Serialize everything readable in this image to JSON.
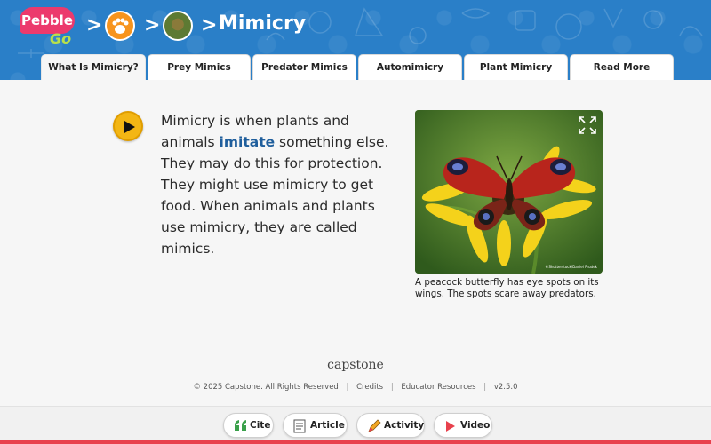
{
  "app": {
    "logo_text_top": "Pebble",
    "logo_text_bottom": "Go"
  },
  "breadcrumb": {
    "sep1": ">",
    "sep2": ">",
    "sep3": ">"
  },
  "page": {
    "title": "Mimicry"
  },
  "tabs": [
    {
      "label": "What Is Mimicry?",
      "active": true
    },
    {
      "label": "Prey Mimics",
      "active": false
    },
    {
      "label": "Predator Mimics",
      "active": false
    },
    {
      "label": "Automimicry",
      "active": false
    },
    {
      "label": "Plant Mimicry",
      "active": false
    },
    {
      "label": "Read More",
      "active": false
    }
  ],
  "article": {
    "line1": "Mimicry is when plants and",
    "line2_pre": "animals ",
    "line2_vocab": "imitate",
    "line2_post": " something else.",
    "line3": "They may do this for protection.",
    "line4": "They might use mimicry to get",
    "line5": "food. When animals and plants",
    "line6": "use mimicry, they are called mimics."
  },
  "photo": {
    "credit": "©Shutterstock/Daniel Prudek",
    "caption": "A peacock butterfly has eye spots on its wings. The spots scare away predators."
  },
  "footer": {
    "brand": "capstone",
    "copyright": "© 2025 Capstone. All Rights Reserved",
    "credits": "Credits",
    "educator": "Educator Resources",
    "version": "v2.5.0",
    "divider": "|"
  },
  "bottom_actions": {
    "cite": "Cite",
    "article": "Article",
    "activity": "Activity",
    "video": "Video"
  },
  "colors": {
    "header": "#2a7fc8",
    "accent_red": "#e8414d",
    "vocab_blue": "#1f5e9c",
    "play_yellow": "#f3b614"
  },
  "icons": {
    "play": "play-icon",
    "expand": "expand-icon",
    "cite": "quote-icon",
    "article": "article-icon",
    "activity": "pencil-icon",
    "video": "video-play-icon"
  }
}
